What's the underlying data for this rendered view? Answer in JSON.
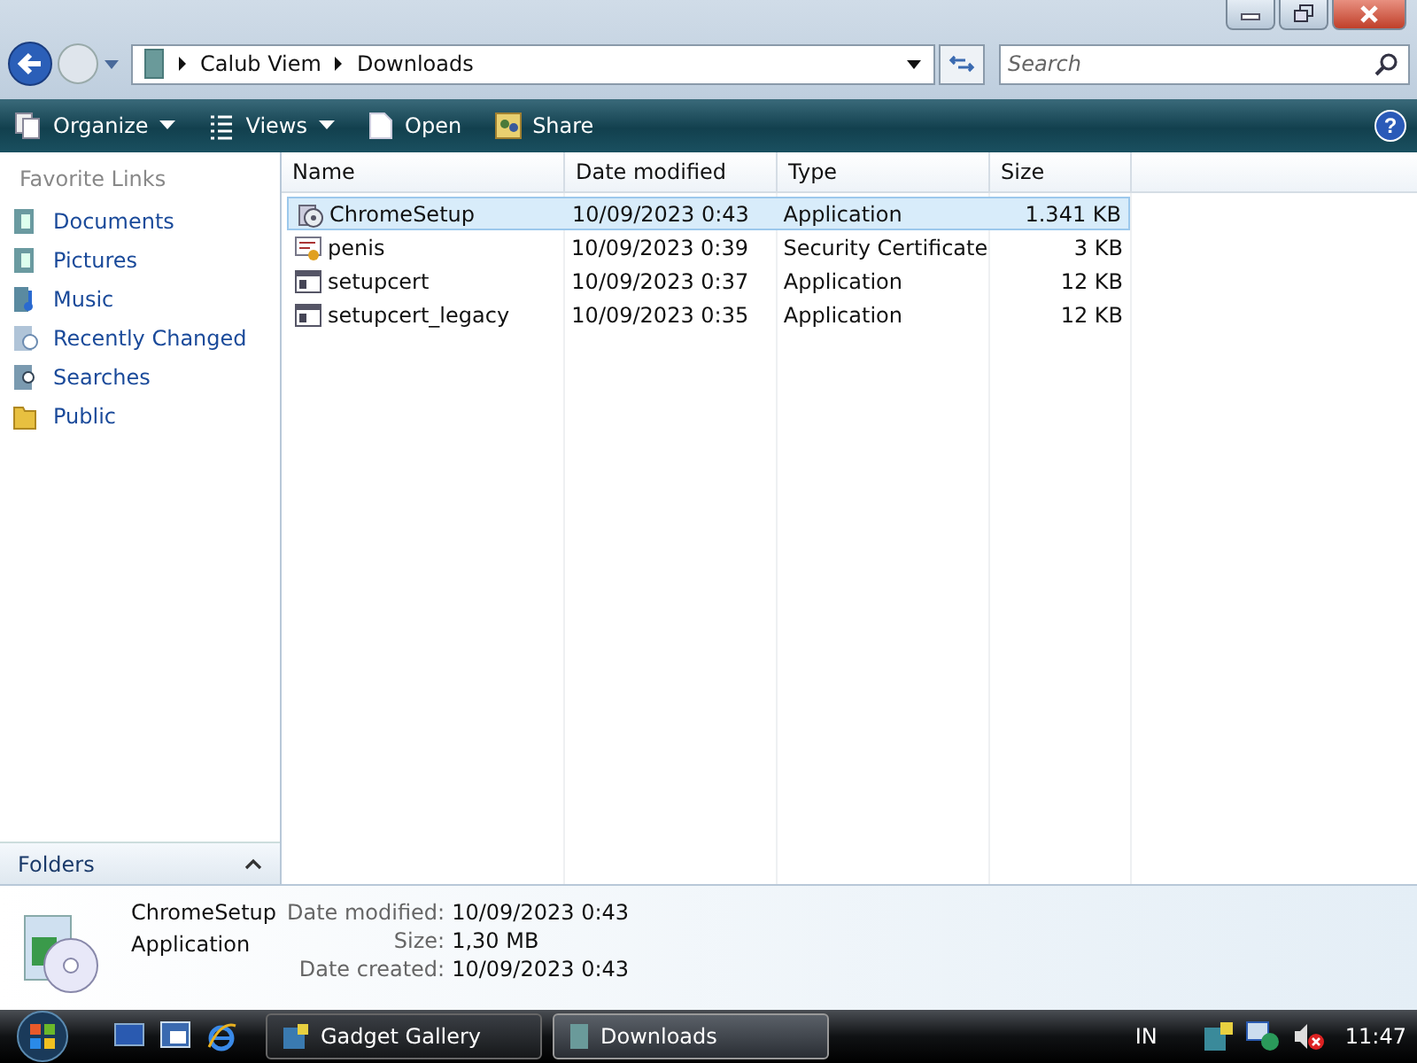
{
  "address": {
    "crumbs": [
      "Calub Viem",
      "Downloads"
    ]
  },
  "search": {
    "placeholder": "Search"
  },
  "toolbar": [
    {
      "label": "Organize",
      "kind": "menu"
    },
    {
      "label": "Views",
      "kind": "menu"
    },
    {
      "label": "Open",
      "kind": "button"
    },
    {
      "label": "Share",
      "kind": "button"
    }
  ],
  "help": "?",
  "sidebar": {
    "heading": "Favorite Links",
    "items": [
      {
        "label": "Documents"
      },
      {
        "label": "Pictures"
      },
      {
        "label": "Music"
      },
      {
        "label": "Recently Changed"
      },
      {
        "label": "Searches"
      },
      {
        "label": "Public"
      }
    ],
    "folders_label": "Folders"
  },
  "table": {
    "columns": [
      "Name",
      "Date modified",
      "Type",
      "Size"
    ],
    "rows": [
      {
        "selected": true,
        "kind": "installer",
        "cells": [
          "ChromeSetup",
          "10/09/2023 0:43",
          "Application",
          "1.341 KB"
        ]
      },
      {
        "selected": false,
        "kind": "certificate",
        "cells": [
          "penis",
          "10/09/2023 0:39",
          "Security Certificate",
          "3 KB"
        ]
      },
      {
        "selected": false,
        "kind": "app",
        "cells": [
          "setupcert",
          "10/09/2023 0:37",
          "Application",
          "12 KB"
        ]
      },
      {
        "selected": false,
        "kind": "app",
        "cells": [
          "setupcert_legacy",
          "10/09/2023 0:35",
          "Application",
          "12 KB"
        ]
      }
    ]
  },
  "details": {
    "name": "ChromeSetup",
    "type": "Application",
    "fields": [
      {
        "label": "Date modified:",
        "value": "10/09/2023 0:43"
      },
      {
        "label": "Size:",
        "value": "1,30 MB"
      },
      {
        "label": "Date created:",
        "value": "10/09/2023 0:43"
      }
    ]
  },
  "taskbar": {
    "windows": [
      {
        "label": "Gadget Gallery",
        "selected": false
      },
      {
        "label": "Downloads",
        "selected": true
      }
    ],
    "language": "IN",
    "clock": "11:47"
  }
}
